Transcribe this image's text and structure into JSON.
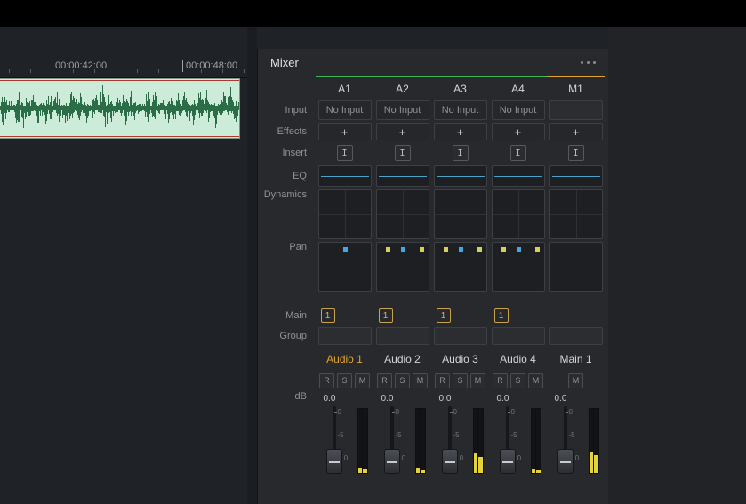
{
  "timeline": {
    "ticks": [
      "00:00:42:00",
      "00:00:48:00"
    ]
  },
  "mixer": {
    "title": "Mixer",
    "row_labels": {
      "input": "Input",
      "effects": "Effects",
      "insert": "Insert",
      "eq": "EQ",
      "dynamics": "Dynamics",
      "pan": "Pan",
      "main": "Main",
      "group": "Group",
      "db": "dB"
    },
    "plus": "+",
    "insert_glyph": "I",
    "strips": [
      {
        "id": "A1",
        "bar": "green",
        "input": "No Input",
        "main_badge": "1",
        "track": "Audio 1",
        "selected": true,
        "rsm": [
          "R",
          "S",
          "M"
        ],
        "db": "0.0",
        "pan_dots": [
          {
            "x": 27,
            "c": "blue"
          }
        ],
        "meter": [
          6,
          4
        ]
      },
      {
        "id": "A2",
        "bar": "green",
        "input": "No Input",
        "main_badge": "1",
        "track": "Audio 2",
        "selected": false,
        "rsm": [
          "R",
          "S",
          "M"
        ],
        "db": "0.0",
        "pan_dots": [
          {
            "x": 10,
            "c": "yell"
          },
          {
            "x": 27,
            "c": "blue"
          },
          {
            "x": 48,
            "c": "yell"
          }
        ],
        "meter": [
          5,
          3
        ]
      },
      {
        "id": "A3",
        "bar": "green",
        "input": "No Input",
        "main_badge": "1",
        "track": "Audio 3",
        "selected": false,
        "rsm": [
          "R",
          "S",
          "M"
        ],
        "db": "0.0",
        "pan_dots": [
          {
            "x": 10,
            "c": "yell"
          },
          {
            "x": 27,
            "c": "blue"
          },
          {
            "x": 48,
            "c": "yell"
          }
        ],
        "meter": [
          22,
          18
        ]
      },
      {
        "id": "A4",
        "bar": "green",
        "input": "No Input",
        "main_badge": "1",
        "track": "Audio 4",
        "selected": false,
        "rsm": [
          "R",
          "S",
          "M"
        ],
        "db": "0.0",
        "pan_dots": [
          {
            "x": 10,
            "c": "yell"
          },
          {
            "x": 27,
            "c": "blue"
          },
          {
            "x": 48,
            "c": "yell"
          }
        ],
        "meter": [
          4,
          3
        ]
      },
      {
        "id": "M1",
        "bar": "orange",
        "input": "",
        "main_badge": "",
        "track": "Main 1",
        "selected": false,
        "rsm": [
          "M"
        ],
        "db": "0.0",
        "pan_dots": [],
        "meter": [
          24,
          20
        ]
      }
    ],
    "scale_ticks": [
      {
        "v": "0",
        "t": 2
      },
      {
        "v": "-5",
        "t": 28
      },
      {
        "v": "-10",
        "t": 54
      }
    ]
  }
}
